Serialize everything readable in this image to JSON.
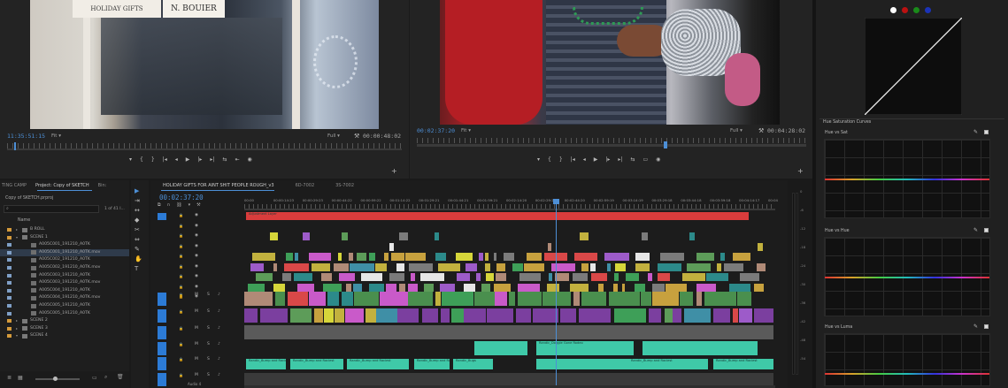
{
  "source_monitor": {
    "sign_left": "HOLIDAY GIFTS",
    "sign_right": "N. BOUIER",
    "timecode": "11:35:51:15",
    "fit": "Fit",
    "quality": "Full",
    "duration": "00:00:48:02"
  },
  "program_monitor": {
    "timecode": "00:02:37:20",
    "fit": "Fit",
    "quality": "Full",
    "duration": "00:04:28:02"
  },
  "transport_glyphs": [
    "▾",
    "{",
    "}",
    "|◂",
    "◂|",
    "◂",
    "▶",
    "|▸",
    "▸|",
    "⇆",
    "⇤",
    "▭",
    "◉"
  ],
  "project_panel": {
    "tabs": [
      "TING CAMP",
      "Project: Copy of SKETCH",
      "Bin: "
    ],
    "active_tab": 1,
    "filename": "Copy of SKETCH.prproj",
    "count": "1 of 41 I...",
    "column_name": "Name",
    "items": [
      {
        "label": "B ROLL",
        "type": "bin",
        "color": "#d49a3b",
        "indent": 1,
        "twirl": "▸"
      },
      {
        "label": "SCENE 1",
        "type": "bin",
        "color": "#d49a3b",
        "indent": 1,
        "twirl": "▾"
      },
      {
        "label": "A005C001_191210_A0TK",
        "type": "clip",
        "color": "#7f9fc6",
        "indent": 2
      },
      {
        "label": "A005C001_191210_A0TK.mov",
        "type": "clip",
        "color": "#7f9fc6",
        "indent": 2,
        "selected": true
      },
      {
        "label": "A005C002_191210_A0TK",
        "type": "clip",
        "color": "#7f9fc6",
        "indent": 2
      },
      {
        "label": "A005C002_191210_A0TK.mov",
        "type": "clip",
        "color": "#7f9fc6",
        "indent": 2
      },
      {
        "label": "A005C003_191210_A0TK",
        "type": "clip",
        "color": "#7f9fc6",
        "indent": 2
      },
      {
        "label": "A005C003_191210_A0TK.mov",
        "type": "clip",
        "color": "#7f9fc6",
        "indent": 2
      },
      {
        "label": "A005C004_191210_A0TK",
        "type": "clip",
        "color": "#7f9fc6",
        "indent": 2
      },
      {
        "label": "A005C004_191210_A0TK.mov",
        "type": "clip",
        "color": "#7f9fc6",
        "indent": 2
      },
      {
        "label": "A005C005_191210_A0TK",
        "type": "clip",
        "color": "#7f9fc6",
        "indent": 2
      },
      {
        "label": "A005C005_191210_A0TK",
        "type": "clip",
        "color": "#7f9fc6",
        "indent": 2
      },
      {
        "label": "SCENE 2",
        "type": "bin",
        "color": "#d49a3b",
        "indent": 1,
        "twirl": "▸"
      },
      {
        "label": "SCENE 3",
        "type": "bin",
        "color": "#d49a3b",
        "indent": 1,
        "twirl": "▸"
      },
      {
        "label": "SCENE 4",
        "type": "bin",
        "color": "#d49a3b",
        "indent": 1,
        "twirl": "▾"
      }
    ]
  },
  "timeline": {
    "tabs": [
      "HOLIDAY GIFTS FOR AINT SHIT PEOPLE ROUGH_v3",
      "6D-7002",
      "3S-7002"
    ],
    "active_tab": 0,
    "timecode": "00:02:37:20",
    "ruler_marks": [
      "00:00",
      "00:00:14:23",
      "00:00:29:23",
      "00:00:44:22",
      "00:00:59:22",
      "00:01:14:22",
      "00:01:29:21",
      "00:01:44:21",
      "00:01:59:21",
      "00:02:14:20",
      "00:02:29:20",
      "00:02:44:20",
      "00:02:59:19",
      "00:03:14:19",
      "00:03:29:18",
      "00:03:44:18",
      "00:03:59:18",
      "00:04:14:17",
      "00:04"
    ],
    "audio_track_label": "Audio 4",
    "audio_clip_label": "Randic_Bump and Raciest",
    "audio_clip_label_2": "Randic_Bugs",
    "audio_clip_label_3": "Randic_Doggie Gone Rodeo",
    "top_clip_label": "Adjustment Layer"
  },
  "tools": [
    "▶",
    "⇥",
    "↔",
    "◆",
    "✂",
    "⇔",
    "✎",
    "✋",
    "T"
  ],
  "vu_ticks": [
    "0",
    "-6",
    "-12",
    "-18",
    "-24",
    "-30",
    "-36",
    "-42",
    "-48",
    "-54"
  ],
  "lumetri": {
    "hue_sat_title": "Hue Saturation Curves",
    "sections": [
      "Hue vs Sat",
      "Hue vs Hue",
      "Hue vs Luma"
    ]
  },
  "colors": {
    "playhead": "#4d8fd6",
    "accent_blue": "#2c7bd6",
    "adjustment_red": "#d93c3c",
    "audio_teal": "#3fc9a8"
  }
}
